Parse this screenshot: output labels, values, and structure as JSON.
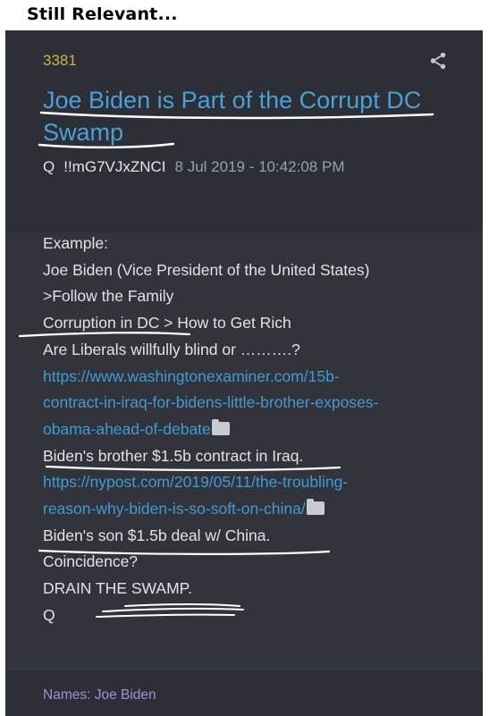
{
  "caption": "Still Relevant...",
  "post": {
    "number": "3381",
    "title": "Joe Biden is Part of the Corrupt DC Swamp",
    "author": "Q",
    "tripcode": "!!mG7VJxZNCI",
    "timestamp": "8 Jul 2019 - 10:42:08 PM",
    "body": {
      "line1": "Example:",
      "line2": "Joe Biden (Vice President of the United States)",
      "line3": ">Follow the Family",
      "line4_a": "Corruption in ",
      "line4_b": "DC",
      "line4_c": " > How to Get Rich",
      "line5": "Are Liberals willfully blind or ……….?",
      "link1_l1": "https://www.washingtonexaminer.com/15b-",
      "link1_l2": "contract-in-iraq-for-bidens-little-brother-exposes-",
      "link1_l3": "obama-ahead-of-debate",
      "line9": "Biden's brother $1.5b contract in Iraq.",
      "link2_l1": "https://nypost.com/2019/05/11/the-troubling-",
      "link2_l2": "reason-why-biden-is-so-soft-on-china/",
      "line12": "Biden's son $1.5b deal w/ China.",
      "line13": "Coincidence?",
      "line14": "DRAIN THE SWAMP.",
      "line15": "Q"
    },
    "names": "Names: Joe Biden"
  },
  "colors": {
    "post_number": "#c9b441",
    "title_link": "#4a9fd6",
    "body_link": "#3f9bd3",
    "names": "#a98bd6",
    "background": "#2c2f36",
    "annotation": "#ffffff"
  },
  "icons": [
    "share-icon",
    "folder-icon"
  ]
}
